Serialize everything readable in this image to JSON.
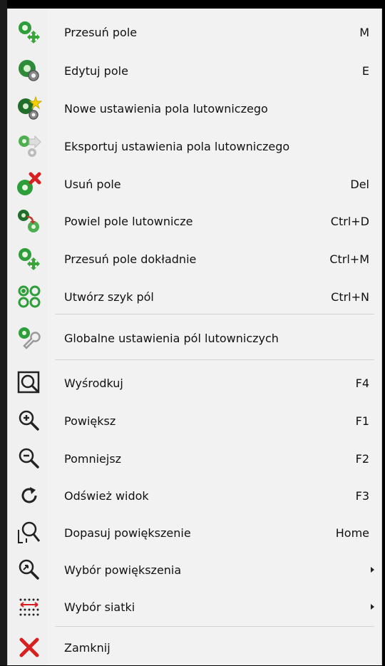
{
  "menu": {
    "items": [
      {
        "label": "Przesuń pole",
        "shortcut": "M",
        "icon": "move-pad-icon"
      },
      {
        "label": "Edytuj pole",
        "shortcut": "E",
        "icon": "edit-pad-icon"
      },
      {
        "label": "Nowe ustawienia pola lutowniczego",
        "shortcut": "",
        "icon": "new-pad-settings-icon"
      },
      {
        "label": "Eksportuj ustawienia pola lutowniczego",
        "shortcut": "",
        "icon": "export-pad-settings-icon"
      },
      {
        "label": "Usuń pole",
        "shortcut": "Del",
        "icon": "delete-pad-icon"
      },
      {
        "label": "Powiel pole lutownicze",
        "shortcut": "Ctrl+D",
        "icon": "duplicate-pad-icon"
      },
      {
        "label": "Przesuń pole dokładnie",
        "shortcut": "Ctrl+M",
        "icon": "move-exact-icon"
      },
      {
        "label": "Utwórz szyk pól",
        "shortcut": "Ctrl+N",
        "icon": "array-pads-icon"
      },
      {
        "label": "Globalne ustawienia pól lutowniczych",
        "shortcut": "",
        "icon": "global-pad-settings-icon"
      },
      {
        "label": "Wyśrodkuj",
        "shortcut": "F4",
        "icon": "center-view-icon"
      },
      {
        "label": "Powiększ",
        "shortcut": "F1",
        "icon": "zoom-in-icon"
      },
      {
        "label": "Pomniejsz",
        "shortcut": "F2",
        "icon": "zoom-out-icon"
      },
      {
        "label": "Odśwież widok",
        "shortcut": "F3",
        "icon": "refresh-icon"
      },
      {
        "label": "Dopasuj powiększenie",
        "shortcut": "Home",
        "icon": "zoom-fit-icon"
      },
      {
        "label": "Wybór powiększenia",
        "shortcut": "",
        "icon": "zoom-select-icon",
        "submenu": true
      },
      {
        "label": "Wybór siatki",
        "shortcut": "",
        "icon": "grid-select-icon",
        "submenu": true
      },
      {
        "label": "Zamknij",
        "shortcut": "",
        "icon": "close-icon"
      }
    ]
  }
}
